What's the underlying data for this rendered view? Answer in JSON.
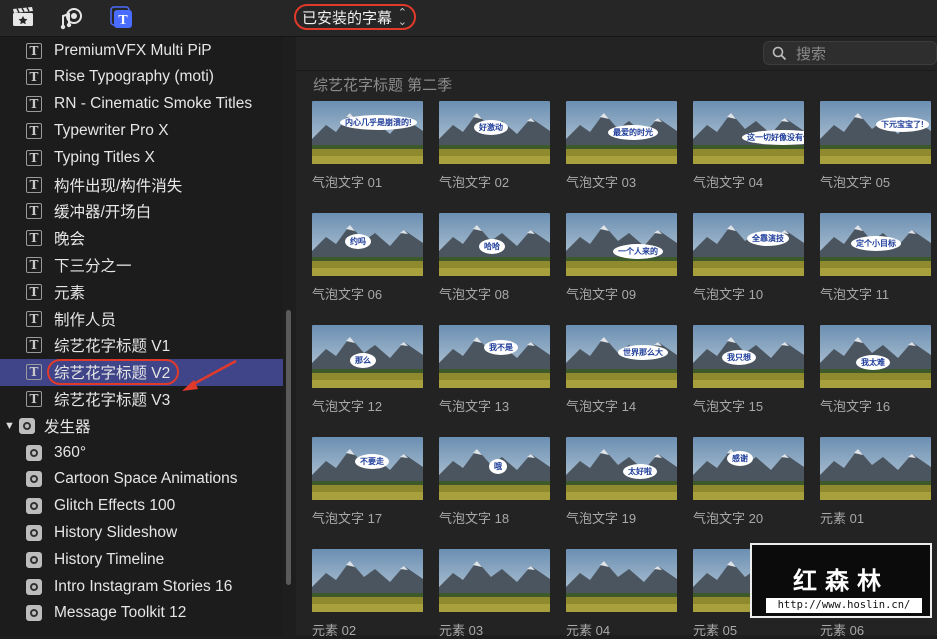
{
  "toolbar": {
    "icons": [
      "clapper-icon",
      "music-camera-icon",
      "titles-icon"
    ],
    "dropdown_label": "已安装的字幕"
  },
  "sidebar": {
    "items": [
      {
        "label": "PremiumVFX Multi PiP",
        "icon": "title-icon"
      },
      {
        "label": "Rise Typography (moti)",
        "icon": "title-icon"
      },
      {
        "label": "RN - Cinematic Smoke Titles",
        "icon": "title-icon"
      },
      {
        "label": "Typewriter Pro X",
        "icon": "title-icon"
      },
      {
        "label": "Typing Titles X",
        "icon": "title-icon"
      },
      {
        "label": "构件出现/构件消失",
        "icon": "title-icon"
      },
      {
        "label": "缓冲器/开场白",
        "icon": "title-icon"
      },
      {
        "label": "晚会",
        "icon": "title-icon"
      },
      {
        "label": "下三分之一",
        "icon": "title-icon"
      },
      {
        "label": "元素",
        "icon": "title-icon"
      },
      {
        "label": "制作人员",
        "icon": "title-icon"
      },
      {
        "label": "综艺花字标题 V1",
        "icon": "title-icon"
      },
      {
        "label": "综艺花字标题 V2",
        "icon": "title-icon",
        "selected": true
      },
      {
        "label": "综艺花字标题 V3",
        "icon": "title-icon"
      },
      {
        "label": "发生器",
        "icon": "generator-folder-icon",
        "folder": true,
        "expanded": true
      },
      {
        "label": "360°",
        "icon": "generator-icon"
      },
      {
        "label": "Cartoon Space Animations",
        "icon": "generator-icon"
      },
      {
        "label": "Glitch Effects 100",
        "icon": "generator-icon"
      },
      {
        "label": "History Slideshow",
        "icon": "generator-icon"
      },
      {
        "label": "History Timeline",
        "icon": "generator-icon"
      },
      {
        "label": "Intro Instagram Stories 16",
        "icon": "generator-icon"
      },
      {
        "label": "Message Toolkit 12",
        "icon": "generator-icon"
      }
    ]
  },
  "browser": {
    "search_placeholder": "搜索",
    "section_title": "综艺花字标题 第二季",
    "thumbnails": [
      {
        "label": "气泡文字 01",
        "bubble": "内心几乎是崩溃的!"
      },
      {
        "label": "气泡文字 02",
        "bubble": "好激动"
      },
      {
        "label": "气泡文字 03",
        "bubble": "最爱的时光"
      },
      {
        "label": "气泡文字 04",
        "bubble": "这一切好像没有什么"
      },
      {
        "label": "气泡文字 05",
        "bubble": "下元宝宝了!"
      },
      {
        "label": "气泡文字 06",
        "bubble": "约吗"
      },
      {
        "label": "气泡文字 08",
        "bubble": "哈哈"
      },
      {
        "label": "气泡文字 09",
        "bubble": "一个人来的"
      },
      {
        "label": "气泡文字 10",
        "bubble": "全靠演技"
      },
      {
        "label": "气泡文字 11",
        "bubble": "定个小目标"
      },
      {
        "label": "气泡文字 12",
        "bubble": "那么"
      },
      {
        "label": "气泡文字 13",
        "bubble": "我不是"
      },
      {
        "label": "气泡文字 14",
        "bubble": "世界那么大"
      },
      {
        "label": "气泡文字 15",
        "bubble": "我只想"
      },
      {
        "label": "气泡文字 16",
        "bubble": "我太难"
      },
      {
        "label": "气泡文字 17",
        "bubble": "不要走"
      },
      {
        "label": "气泡文字 18",
        "bubble": "哦"
      },
      {
        "label": "气泡文字 19",
        "bubble": "太好啦"
      },
      {
        "label": "气泡文字 20",
        "bubble": "感谢"
      },
      {
        "label": "元素 01",
        "bubble": ""
      },
      {
        "label": "元素 02",
        "bubble": ""
      },
      {
        "label": "元素 03",
        "bubble": ""
      },
      {
        "label": "元素 04",
        "bubble": ""
      },
      {
        "label": "元素 05",
        "bubble": ""
      },
      {
        "label": "元素 06",
        "bubble": ""
      }
    ]
  },
  "watermark": {
    "title": "红森林",
    "url": "http://www.hoslin.cn/"
  },
  "colors": {
    "selection": "#3f4588",
    "annotation": "#e23a2a",
    "accent": "#4a6cff"
  }
}
